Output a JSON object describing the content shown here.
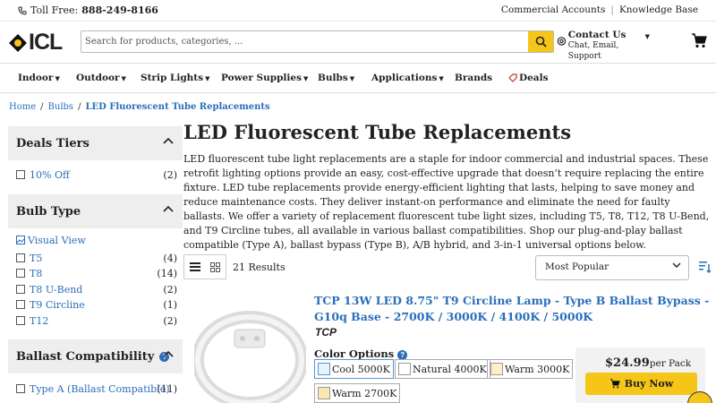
{
  "topbar": {
    "toll_label": "Toll Free:",
    "toll_number": "888-249-8166",
    "link_commercial": "Commercial Accounts",
    "link_kb": "Knowledge Base"
  },
  "header": {
    "logo_text": "ICL",
    "search_placeholder": "Search for products, categories, ...",
    "contact_title": "Contact Us",
    "contact_sub": "Chat, Email, Support"
  },
  "nav": [
    "Indoor",
    "Outdoor",
    "Strip Lights",
    "Power Supplies",
    "Bulbs",
    "Applications",
    "Brands",
    "Deals"
  ],
  "breadcrumb": {
    "home": "Home",
    "bulbs": "Bulbs",
    "current": "LED Fluorescent Tube Replacements"
  },
  "sidebar": {
    "deals_title": "Deals Tiers",
    "deals": [
      {
        "label": "10% Off",
        "count": "(2)"
      }
    ],
    "bulb_title": "Bulb Type",
    "visual_view": "Visual View",
    "bulb_types": [
      {
        "label": "T5",
        "count": "(4)"
      },
      {
        "label": "T8",
        "count": "(14)"
      },
      {
        "label": "T8 U-Bend",
        "count": "(2)"
      },
      {
        "label": "T9 Circline",
        "count": "(1)"
      },
      {
        "label": "T12",
        "count": "(2)"
      }
    ],
    "ballast_title": "Ballast Compatibility",
    "ballast": [
      {
        "label": "Type A (Ballast Compatible)",
        "count": "(11)"
      }
    ]
  },
  "main": {
    "title": "LED Fluorescent Tube Replacements",
    "description": "LED fluorescent tube light replacements are a staple for indoor commercial and industrial spaces. These retrofit lighting options provide an easy, cost-effective upgrade that doesn’t require replacing the entire fixture. LED tube replacements provide energy-efficient lighting that lasts, helping to save money and reduce maintenance costs. They deliver instant-on performance and eliminate the need for faulty ballasts. We offer a variety of replacement fluorescent tube light sizes, including T5, T8, T12, T8 U-Bend, and T9 Circline tubes, all available in various ballast compatibilities. Shop our plug-and-play ballast compatible (Type A), ballast bypass (Type B), A/B hybrid, and 3-in-1 universal options below.",
    "results": "21 Results",
    "sort_selected": "Most Popular"
  },
  "product": {
    "title": "TCP 13W LED 8.75\" T9 Circline Lamp - Type B Ballast Bypass - G10q Base - 2700K / 3000K / 4100K / 5000K",
    "brand": "TCP",
    "color_label": "Color Options",
    "colors": [
      "Cool 5000K",
      "Natural 4000K",
      "Warm 3000K",
      "Warm 2700K"
    ],
    "price": "$24.99",
    "per": "per Pack",
    "buy_label": "Buy Now"
  },
  "colors": {
    "accent": "#f5c518",
    "link": "#2a6ebb"
  }
}
